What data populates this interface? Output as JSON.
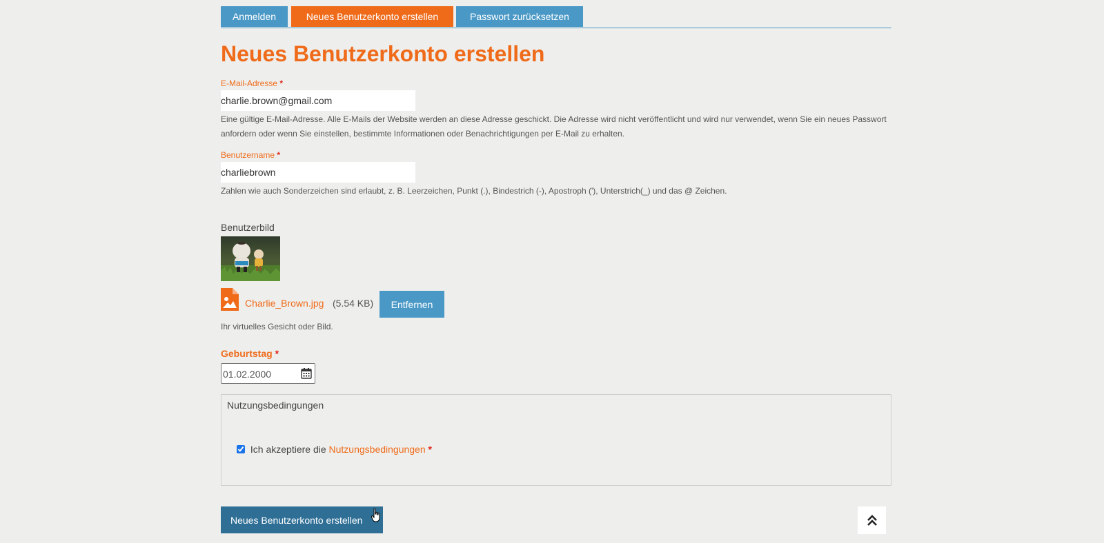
{
  "tabs": [
    {
      "label": "Anmelden",
      "active": false
    },
    {
      "label": "Neues Benutzerkonto erstellen",
      "active": true
    },
    {
      "label": "Passwort zurücksetzen",
      "active": false
    }
  ],
  "page_title": "Neues Benutzerkonto erstellen",
  "email": {
    "label": "E-Mail-Adresse",
    "required_mark": "*",
    "value": "charlie.brown@gmail.com",
    "help": "Eine gültige E-Mail-Adresse. Alle E-Mails der Website werden an diese Adresse geschickt. Die Adresse wird nicht veröffentlicht und wird nur verwendet, wenn Sie ein neues Passwort anfordern oder wenn Sie einstellen, bestimmte Informationen oder Benachrichtigungen per E-Mail zu erhalten."
  },
  "username": {
    "label": "Benutzername",
    "required_mark": "*",
    "value": "charliebrown",
    "help": "Zahlen wie auch Sonderzeichen sind erlaubt, z. B. Leerzeichen, Punkt (.), Bindestrich (-), Apostroph ('), Unterstrich(_) und das @ Zeichen."
  },
  "picture": {
    "label": "Benutzerbild",
    "file_name": "Charlie_Brown.jpg",
    "file_size": "(5.54 KB)",
    "remove_label": "Entfernen",
    "help": "Ihr virtuelles Gesicht oder Bild."
  },
  "birthday": {
    "label": "Geburtstag",
    "required_mark": "*",
    "value": "01.02.2000"
  },
  "terms": {
    "legend": "Nutzungsbedingungen",
    "accept_prefix": "Ich akzeptiere die",
    "link_label": "Nutzungsbedingungen",
    "required_mark": "*",
    "checked": true
  },
  "submit_label": "Neues Benutzerkonto erstellen",
  "colors": {
    "accent_orange": "#ef6b1a",
    "tab_blue": "#4a98c6",
    "submit_blue": "#2f6f96",
    "background": "#eeeeec"
  },
  "icons": [
    "image-file-icon",
    "calendar-icon",
    "chevron-double-up-icon",
    "hand-cursor-icon"
  ]
}
